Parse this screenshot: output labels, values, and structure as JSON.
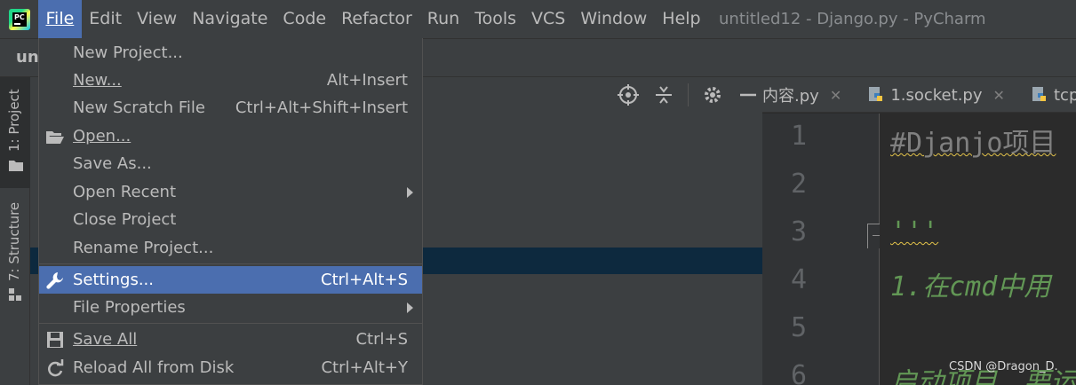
{
  "app": {
    "logo_text": "PC"
  },
  "menubar": {
    "items": [
      {
        "label": "File",
        "active": true
      },
      {
        "label": "Edit"
      },
      {
        "label": "View"
      },
      {
        "label": "Navigate"
      },
      {
        "label": "Code"
      },
      {
        "label": "Refactor"
      },
      {
        "label": "Run"
      },
      {
        "label": "Tools"
      },
      {
        "label": "VCS"
      },
      {
        "label": "Window"
      },
      {
        "label": "Help"
      }
    ]
  },
  "window_title": "untitled12 - Django.py - PyCharm",
  "navbar": {
    "crumb": "unt"
  },
  "toolstrip": {
    "project_tab": "1: Project",
    "structure_tab": "7: Structure"
  },
  "file_menu": {
    "items": [
      {
        "label": "New Project...",
        "shortcut": ""
      },
      {
        "label": "New...",
        "shortcut": "Alt+Insert"
      },
      {
        "label": "New Scratch File",
        "shortcut": "Ctrl+Alt+Shift+Insert"
      },
      {
        "label": "Open...",
        "shortcut": "",
        "icon": "folder-open-icon"
      },
      {
        "label": "Save As...",
        "shortcut": ""
      },
      {
        "label": "Open Recent",
        "shortcut": "",
        "submenu": true
      },
      {
        "label": "Close Project",
        "shortcut": ""
      },
      {
        "label": "Rename Project...",
        "shortcut": ""
      },
      {
        "label": "Settings...",
        "shortcut": "Ctrl+Alt+S",
        "icon": "wrench-icon",
        "selected": true
      },
      {
        "label": "File Properties",
        "shortcut": "",
        "submenu": true
      },
      {
        "label": "Save All",
        "shortcut": "Ctrl+S",
        "icon": "save-icon"
      },
      {
        "label": "Reload All from Disk",
        "shortcut": "Ctrl+Alt+Y",
        "icon": "reload-icon"
      }
    ]
  },
  "editor_tabs": [
    {
      "label": "内容.py",
      "icon": ""
    },
    {
      "label": "1.socket.py",
      "icon": "python-file-icon"
    },
    {
      "label": "tcp_s",
      "icon": "python-file-icon"
    }
  ],
  "editor": {
    "line_numbers": [
      "1",
      "2",
      "3",
      "4",
      "5",
      "6"
    ],
    "lines": [
      {
        "text": "#Djanjo项目",
        "style": "comment"
      },
      {
        "text": "",
        "style": ""
      },
      {
        "text": "'''",
        "style": "doc"
      },
      {
        "text": "1.在cmd中用",
        "style": "doc"
      },
      {
        "text": "",
        "style": ""
      },
      {
        "text": "启动项目，要运",
        "style": "doc"
      }
    ]
  },
  "watermark": "CSDN @Dragon_D.",
  "colors": {
    "menu_selection": "#4b6eaf",
    "background": "#3c3f41",
    "editor_bg": "#2b2b2b",
    "doc_green": "#629755"
  }
}
